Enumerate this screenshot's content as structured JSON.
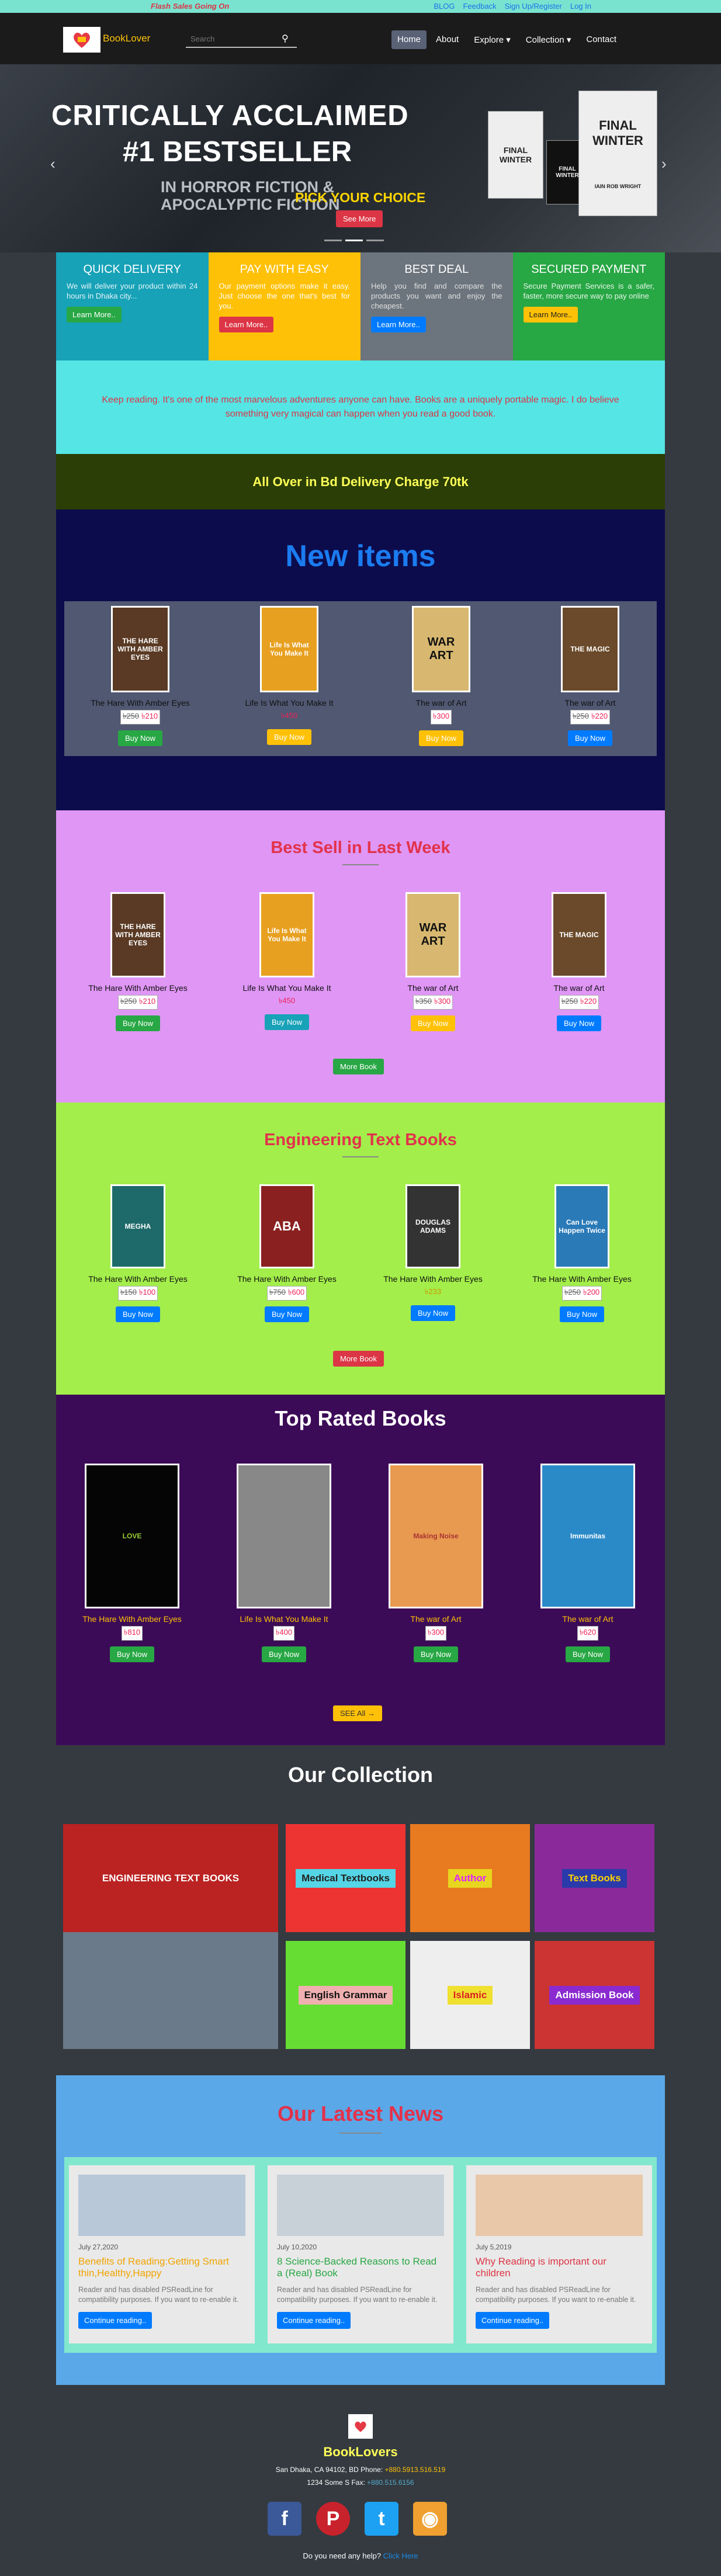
{
  "topbar": {
    "flash": "Flash Sales Going On",
    "links": [
      "BLOG",
      "Feedback",
      "Sign Up/Register",
      "Log In"
    ]
  },
  "nav": {
    "brand": "BookLover",
    "search_placeholder": "Search",
    "menu": [
      "Home",
      "About",
      "Explore ▾",
      "Collection ▾",
      "Contact"
    ]
  },
  "hero": {
    "line1": "CRITICALLY ACCLAIMED",
    "line2": "#1 BESTSELLER",
    "line3": "IN HORROR FICTION &",
    "line4": "APOCALYPTIC FICTION",
    "pick": "PICK YOUR CHOICE",
    "button": "See More",
    "book_title": "FINAL WINTER",
    "book_author": "IAIN ROB WRIGHT"
  },
  "features": [
    {
      "title": "QUICK DELIVERY",
      "text": "We will deliver your product within 24 hours in Dhaka city...",
      "button": "Learn More..",
      "bg": "#17a2b8"
    },
    {
      "title": "PAY WITH EASY",
      "text": "Our payment options make it easy. Just choose the one that's best for you.",
      "button": "Learn More..",
      "bg": "#ffc107"
    },
    {
      "title": "BEST DEAL",
      "text": "Help you find and compare the products you want and enjoy the cheapest.",
      "button": "Learn More..",
      "bg": "#6c757d"
    },
    {
      "title": "SECURED PAYMENT",
      "text": "Secure Payment Services is a safer, faster, more secure way to pay online",
      "button": "Learn More..",
      "bg": "#28a745"
    }
  ],
  "quote": "Keep reading. It's one of the most marvelous adventures anyone can have. Books are a uniquely portable magic. I do believe something very magical can happen when you read a good book.",
  "delivery": "All Over in Bd Delivery Charge 70tk",
  "new_items": {
    "heading": "New items",
    "items": [
      {
        "title": "The Hare With Amber Eyes",
        "old": "250",
        "price": "210",
        "button": "Buy Now"
      },
      {
        "title": "Life Is What You Make It",
        "old": "",
        "price": "450",
        "button": "Buy Now"
      },
      {
        "title": "The war of Art",
        "old": "",
        "price": "300",
        "button": "Buy Now"
      },
      {
        "title": "The war of Art",
        "old": "250",
        "price": "220",
        "button": "Buy Now"
      }
    ]
  },
  "best_sell": {
    "heading": "Best Sell in Last Week",
    "more": "More Book",
    "items": [
      {
        "title": "The Hare With Amber Eyes",
        "old": "250",
        "price": "210",
        "button": "Buy Now"
      },
      {
        "title": "Life Is What You Make It",
        "old": "",
        "price": "450",
        "button": "Buy Now"
      },
      {
        "title": "The war of Art",
        "old": "350",
        "price": "300",
        "button": "Buy Now"
      },
      {
        "title": "The war of Art",
        "old": "250",
        "price": "220",
        "button": "Buy Now"
      }
    ]
  },
  "engineering": {
    "heading": "Engineering Text Books",
    "more": "More Book",
    "items": [
      {
        "title": "The Hare With Amber Eyes",
        "old": "150",
        "price": "100",
        "button": "Buy Now"
      },
      {
        "title": "The Hare With Amber Eyes",
        "old": "750",
        "price": "600",
        "button": "Buy Now"
      },
      {
        "title": "The Hare With Amber Eyes",
        "old": "",
        "price": "233",
        "button": "Buy Now"
      },
      {
        "title": "The Hare With Amber Eyes",
        "old": "250",
        "price": "200",
        "button": "Buy Now"
      }
    ]
  },
  "top_rated": {
    "heading": "Top Rated Books",
    "see_all": "SEE All →",
    "items": [
      {
        "title": "The Hare With Amber Eyes",
        "price": "810",
        "button": "Buy Now"
      },
      {
        "title": "Life Is What You Make It",
        "price": "400",
        "button": "Buy Now"
      },
      {
        "title": "The war of Art",
        "price": "300",
        "button": "Buy Now"
      },
      {
        "title": "The war of Art",
        "price": "620",
        "button": "Buy Now"
      }
    ]
  },
  "collection": {
    "heading": "Our Collection",
    "tiles": [
      "ENGINEERING TEXT BOOKS",
      "Medical Textbooks",
      "Author",
      "Text Books",
      "English Grammar",
      "Islamic",
      "Admission Book"
    ]
  },
  "news": {
    "heading": "Our Latest News",
    "items": [
      {
        "date": "July 27,2020",
        "title": "Benefits of Reading:Getting Smart thin,Healthy,Happy",
        "text": "Reader and has disabled PSReadLine for compatibility purposes. If you want to re-enable it.",
        "button": "Continue reading..",
        "color": "#f0a400"
      },
      {
        "date": "July 10,2020",
        "title": "8 Science-Backed Reasons to Read a (Real) Book",
        "text": "Reader and has disabled PSReadLine for compatibility purposes. If you want to re-enable it.",
        "button": "Continue reading..",
        "color": "#28a745"
      },
      {
        "date": "July 5,2019",
        "title": "Why Reading is important our children",
        "text": "Reader and has disabled PSReadLine for compatibility purposes. If you want to re-enable it.",
        "button": "Continue reading..",
        "color": "#dc3545"
      }
    ]
  },
  "footer": {
    "brand": "BookLovers",
    "address": "San Dhaka, CA 94102, BD Phone: ",
    "phone": "+880.5913.516.519",
    "mail_prefix": "1234 Some S Fax: ",
    "fax": "+880.515.6156",
    "help": "Do you need any help? ",
    "help_link": "Click Here"
  }
}
